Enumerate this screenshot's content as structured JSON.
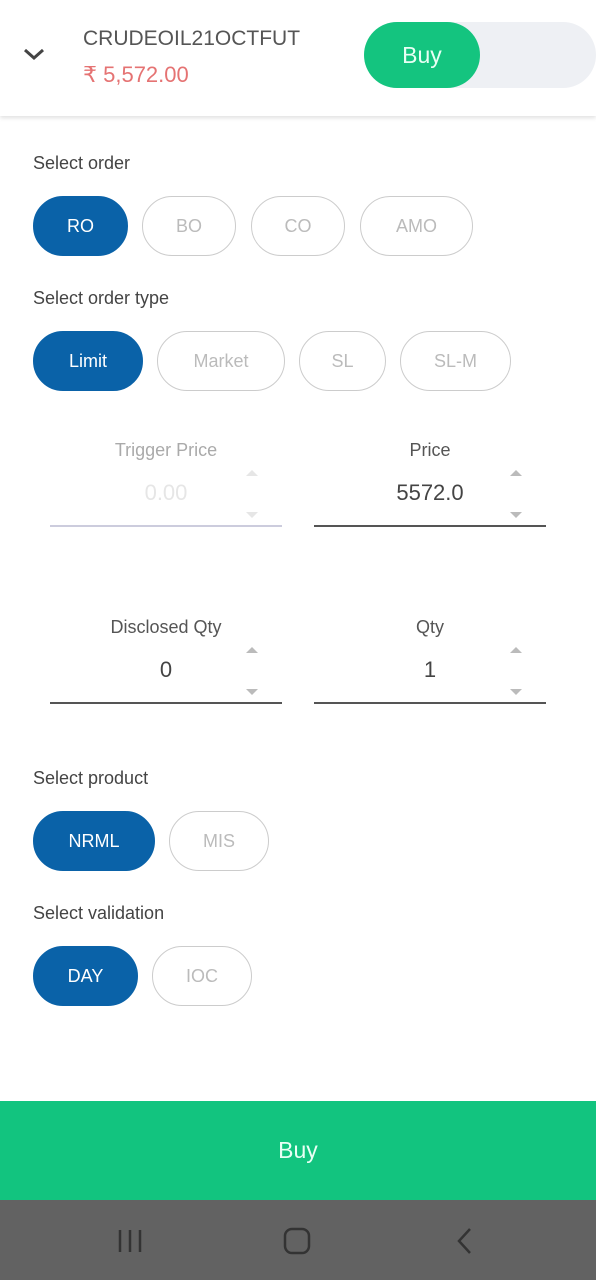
{
  "header": {
    "symbol": "CRUDEOIL21OCTFUT",
    "ltp": "₹ 5,572.00",
    "toggle_label": "Buy",
    "collapse_icon": "chevron-down-icon"
  },
  "select_order": {
    "label": "Select order",
    "options": [
      "RO",
      "BO",
      "CO",
      "AMO"
    ],
    "selected": "RO"
  },
  "order_type": {
    "label": "Select order type",
    "options": [
      "Limit",
      "Market",
      "SL",
      "SL-M"
    ],
    "selected": "Limit"
  },
  "fields": {
    "trigger_price": {
      "label": "Trigger Price",
      "value": "0.00",
      "disabled": true
    },
    "price": {
      "label": "Price",
      "value": "5572.0"
    },
    "disclosed_qty": {
      "label": "Disclosed Qty",
      "value": "0"
    },
    "qty": {
      "label": "Qty",
      "value": "1"
    }
  },
  "product": {
    "label": "Select product",
    "options": [
      "NRML",
      "MIS"
    ],
    "selected": "NRML"
  },
  "validation": {
    "label": "Select validation",
    "options": [
      "DAY",
      "IOC"
    ],
    "selected": "DAY"
  },
  "submit_label": "Buy",
  "colors": {
    "accent": "#0a62a8",
    "buy": "#12c47f",
    "price": "#e57373"
  },
  "nav": {
    "icons": [
      "recent-apps-icon",
      "home-icon",
      "back-icon"
    ]
  }
}
